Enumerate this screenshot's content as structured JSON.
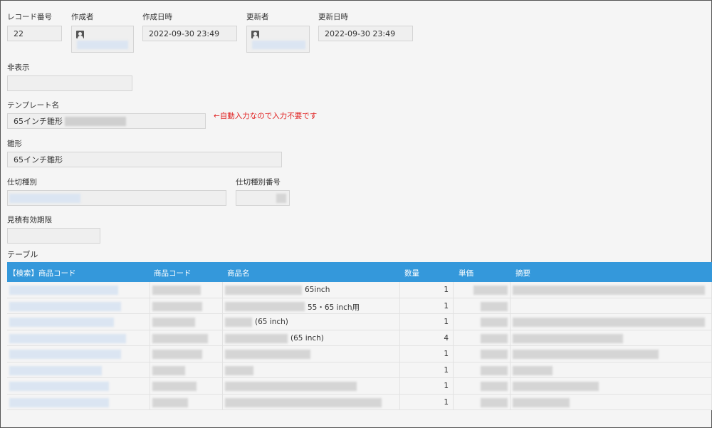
{
  "record": {
    "record_number_label": "レコード番号",
    "record_number": "22",
    "creator_label": "作成者",
    "created_at_label": "作成日時",
    "created_at": "2022-09-30 23:49",
    "updater_label": "更新者",
    "updated_at_label": "更新日時",
    "updated_at": "2022-09-30 23:49"
  },
  "hidden_label": "非表示",
  "template_label": "テンプレート名",
  "template_value": "65インチ雛形",
  "template_note": "←自動入力なので入力不要です",
  "hinagata_label": "雛形",
  "hinagata_value": "65インチ雛形",
  "shikiri_label": "仕切種別",
  "shikiri_number_label": "仕切種別番号",
  "expiry_label": "見積有効期限",
  "table_label": "テーブル",
  "table": {
    "headers": [
      "【検索】商品コード",
      "商品コード",
      "商品名",
      "数量",
      "単価",
      "摘要"
    ],
    "rows": [
      {
        "name_suffix": "65inch",
        "qty": "1"
      },
      {
        "name_suffix": "55・65 inch用",
        "qty": "1"
      },
      {
        "name_suffix": "(65 inch)",
        "qty": "1"
      },
      {
        "name_suffix": "(65 inch)",
        "qty": "4"
      },
      {
        "name_suffix": "",
        "qty": "1"
      },
      {
        "name_suffix": "",
        "qty": "1"
      },
      {
        "name_suffix": "",
        "qty": "1"
      },
      {
        "name_suffix": "",
        "qty": "1"
      }
    ]
  },
  "icons": {
    "user": "user-icon"
  }
}
